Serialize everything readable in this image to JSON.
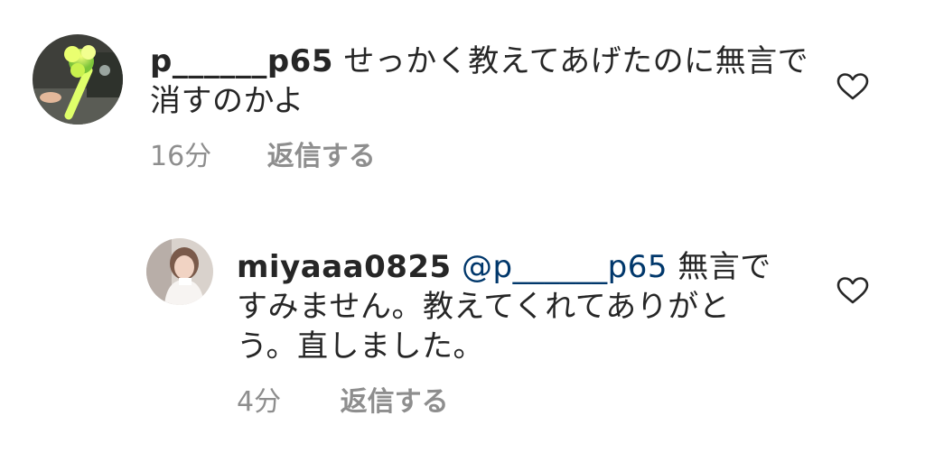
{
  "comments": [
    {
      "username": "p______p65",
      "text": "せっかく教えてあげたのに無言で消すのかよ",
      "time": "16分",
      "reply_label": "返信する",
      "avatar_icon": "avatar-glowstick-icon",
      "like_icon": "heart-outline-icon"
    },
    {
      "username": "miyaaa0825",
      "mention": "@p______p65",
      "text": "無言ですみません。教えてくれてありがとう。直しました。",
      "time": "4分",
      "reply_label": "返信する",
      "avatar_icon": "avatar-person-icon",
      "like_icon": "heart-outline-icon"
    }
  ],
  "colors": {
    "text": "#262626",
    "meta": "#8e8e8e",
    "mention": "#00376b",
    "background": "#ffffff"
  }
}
